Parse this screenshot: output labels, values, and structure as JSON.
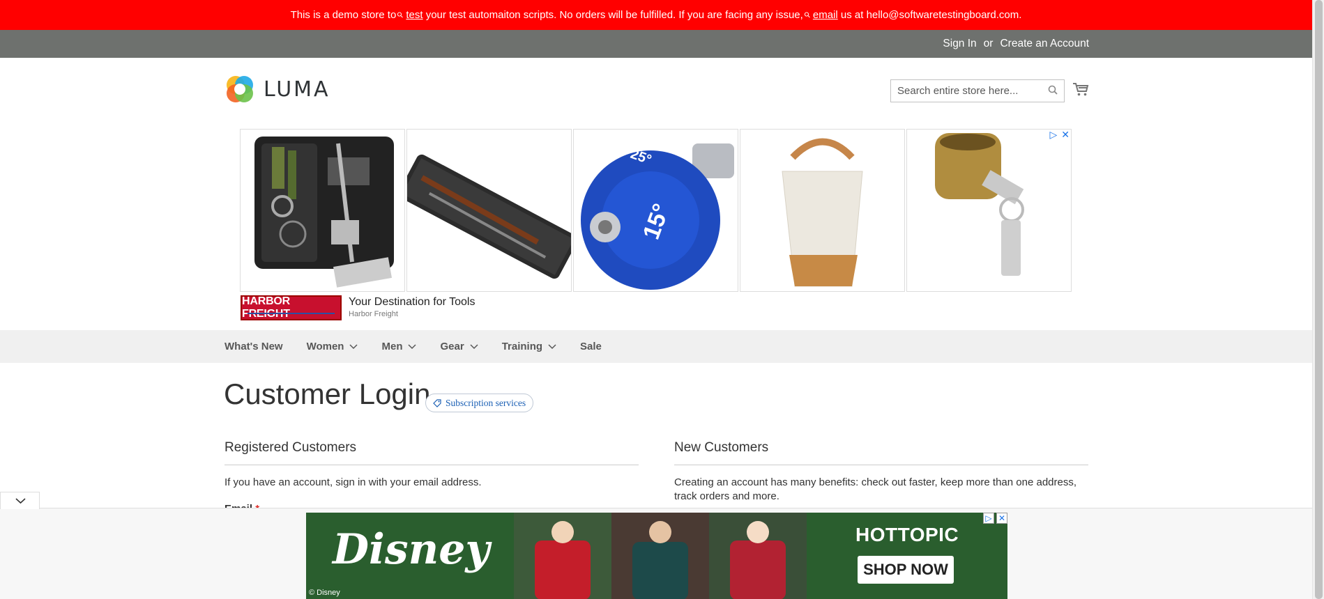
{
  "demo_banner": {
    "part1": "This is a demo store to",
    "link1": "test",
    "part2": "your test automaiton scripts. No orders will be fulfilled. If you are facing any issue,",
    "link2": "email",
    "part3": "us at hello@softwaretestingboard.com."
  },
  "header": {
    "sign_in": "Sign In",
    "or": "or",
    "create_account": "Create an Account"
  },
  "logo": {
    "text": "LUMA"
  },
  "search": {
    "placeholder": "Search entire store here..."
  },
  "ad": {
    "brand": "HARBOR FREIGHT",
    "tagline": "Your Destination for Tools",
    "advertiser": "Harbor Freight",
    "dial_big": "15°",
    "dial_small": "25°"
  },
  "nav": {
    "items": [
      {
        "label": "What's New"
      },
      {
        "label": "Women"
      },
      {
        "label": "Men"
      },
      {
        "label": "Gear"
      },
      {
        "label": "Training"
      },
      {
        "label": "Sale"
      }
    ]
  },
  "page": {
    "title": "Customer Login",
    "badge": "Subscription services"
  },
  "registered": {
    "title": "Registered Customers",
    "text": "If you have an account, sign in with your email address.",
    "email_label": "Email",
    "required_mark": "*"
  },
  "new_customers": {
    "title": "New Customers",
    "text": "Creating an account has many benefits: check out faster, keep more than one address, track orders and more."
  },
  "bottom_ad": {
    "brand": "Disney",
    "copyright": "© Disney",
    "retailer": "HOTTOPIC",
    "cta": "SHOP NOW"
  },
  "colors": {
    "banner": "#ff0000",
    "header": "#6e716e",
    "nav": "#f0f0f0",
    "link": "#1a5fb4"
  }
}
